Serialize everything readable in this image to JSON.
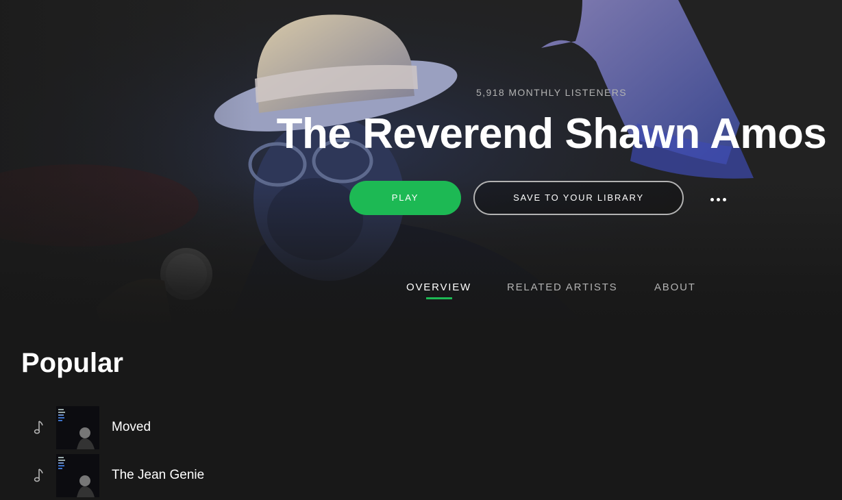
{
  "artist": {
    "monthly_listeners": "5,918 MONTHLY LISTENERS",
    "name": "The Reverend Shawn Amos"
  },
  "actions": {
    "play_label": "PLAY",
    "save_label": "SAVE TO YOUR LIBRARY",
    "more_icon": "ellipsis-icon"
  },
  "tabs": [
    {
      "label": "OVERVIEW",
      "active": true
    },
    {
      "label": "RELATED ARTISTS",
      "active": false
    },
    {
      "label": "ABOUT",
      "active": false
    }
  ],
  "popular": {
    "title": "Popular",
    "tracks": [
      {
        "title": "Moved",
        "icon": "music-note-icon"
      },
      {
        "title": "The Jean Genie",
        "icon": "music-note-icon"
      }
    ]
  },
  "colors": {
    "accent": "#1db954",
    "background": "#181818",
    "muted_text": "#b3b3b3"
  }
}
